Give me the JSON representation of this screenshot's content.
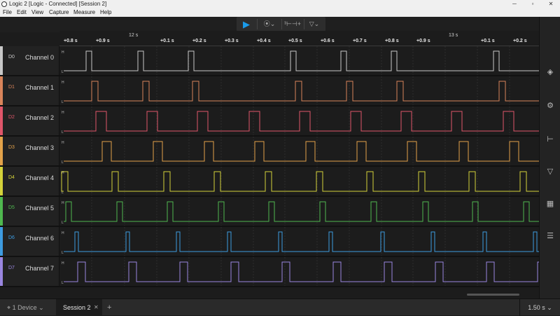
{
  "window": {
    "title": "Logic 2 [Logic - Connected] [Session 2]",
    "minimize": "─",
    "maximize": "▫",
    "close": "✕"
  },
  "menu": [
    "File",
    "Edit",
    "View",
    "Capture",
    "Measure",
    "Help"
  ],
  "toolbar": {
    "play_icon": "▶",
    "trigger_icon": "⦿⌄",
    "measure_icon": "³⊢⊣+",
    "filter_icon": "▽⌄"
  },
  "ruler": {
    "seconds": [
      "12 s",
      "13 s"
    ],
    "ticks": [
      "+0.8 s",
      "+0.9 s",
      "+0.1 s",
      "+0.2 s",
      "+0.3 s",
      "+0.4 s",
      "+0.5 s",
      "+0.6 s",
      "+0.7 s",
      "+0.8 s",
      "+0.9 s",
      "+0.1 s",
      "+0.2 s"
    ]
  },
  "level_labels": {
    "high": "H",
    "low": "L"
  },
  "channels": [
    {
      "id": "D0",
      "name": "Channel 0",
      "color": "#c8c8c8"
    },
    {
      "id": "D1",
      "name": "Channel 1",
      "color": "#d9845a"
    },
    {
      "id": "D2",
      "name": "Channel 2",
      "color": "#e0566a"
    },
    {
      "id": "D3",
      "name": "Channel 3",
      "color": "#e3a24a"
    },
    {
      "id": "D4",
      "name": "Channel 4",
      "color": "#d4d23a"
    },
    {
      "id": "D5",
      "name": "Channel 5",
      "color": "#4fb84f"
    },
    {
      "id": "D6",
      "name": "Channel 6",
      "color": "#3d9be0"
    },
    {
      "id": "D7",
      "name": "Channel 7",
      "color": "#9a86e0"
    }
  ],
  "sidebar_icons": [
    "layers-icon",
    "analyzer-icon",
    "measure-icon",
    "filter-icon",
    "extensions-icon",
    "notes-icon"
  ],
  "status": {
    "device": "1 Device",
    "session": "Session 2",
    "session_close": "✕",
    "add_tab": "+",
    "zoom": "1.50 s"
  }
}
